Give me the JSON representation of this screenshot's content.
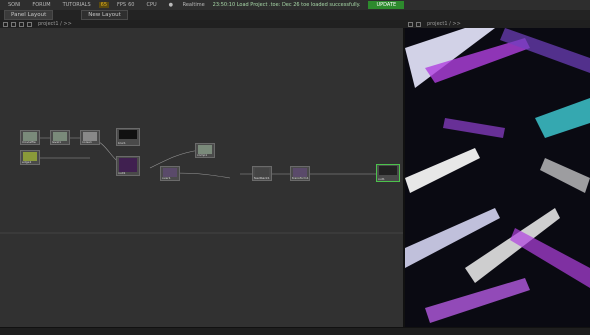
{
  "menubar": {
    "items": [
      "SONI",
      "FORUM",
      "TUTORIALS",
      "FPS",
      "CPU"
    ],
    "badge": "65",
    "fps_value": "60",
    "realtime_label": "Realtime",
    "status": "23:50:10 Load Project .toe: Dec 26 toe loaded successfully.",
    "update_label": "UPDATE"
  },
  "tabs": {
    "active": "Panel Layout",
    "new": "New Layout"
  },
  "network_path": "project1 / >>",
  "viewer_path": "project1 / >>",
  "nodes": [
    {
      "label": "moviefile"
    },
    {
      "label": "level1"
    },
    {
      "label": "noise1"
    },
    {
      "label": "blur1"
    },
    {
      "label": "edge1"
    },
    {
      "label": "null1"
    },
    {
      "label": "over1"
    },
    {
      "label": "comp1"
    },
    {
      "label": "feedback1"
    },
    {
      "label": "transform1"
    },
    {
      "label": "out1"
    }
  ],
  "colors": {
    "accent": "#2d8a2d",
    "viewer_purple": "#b040e0",
    "viewer_cyan": "#40d0d8"
  }
}
